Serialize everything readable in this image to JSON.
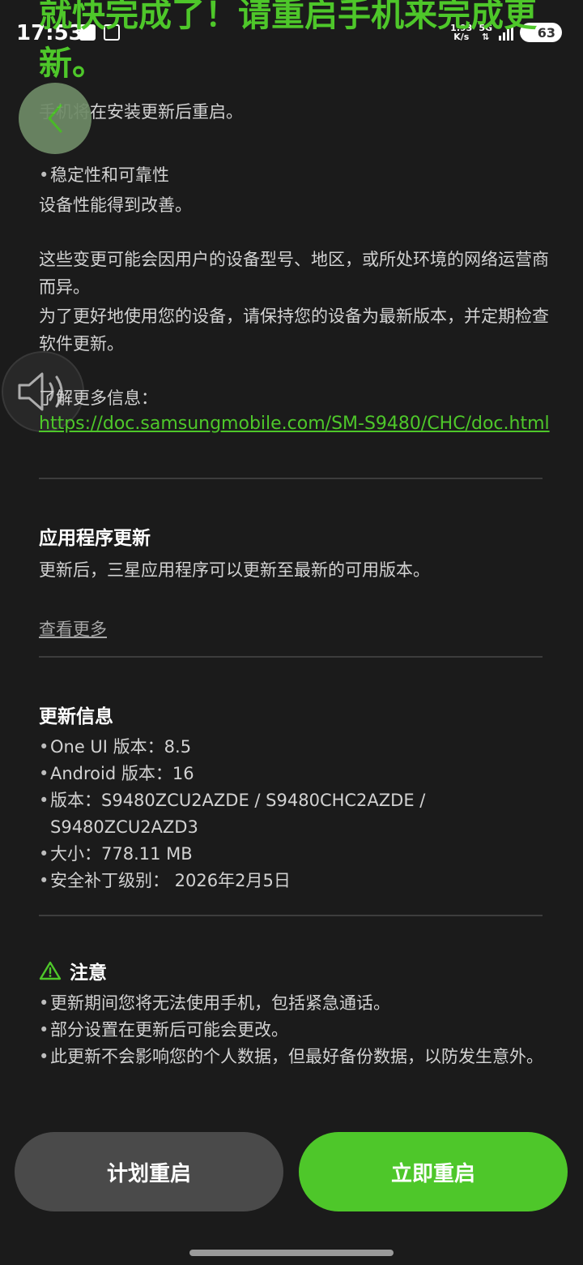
{
  "status_bar": {
    "time": "17:53",
    "net_speed_value": "1.93",
    "net_speed_unit": "K/s",
    "network_type": "5G",
    "battery": "63"
  },
  "title": "就快完成了！请重启手机来完成更新。",
  "intro_text": "手机将在安装更新后重启。",
  "stability": {
    "bullet": "稳定性和可靠性",
    "desc": "设备性能得到改善。"
  },
  "disclaimer_1": "这些变更可能会因用户的设备型号、地区，或所处环境的网络运营商而异。",
  "disclaimer_2": "为了更好地使用您的设备，请保持您的设备为最新版本，并定期检查软件更新。",
  "more_info_label": "了解更多信息：",
  "more_info_url": "https://doc.samsungmobile.com/SM-S9480/CHC/doc.html",
  "app_update": {
    "title": "应用程序更新",
    "desc": "更新后，三星应用程序可以更新至最新的可用版本。",
    "more_link": "查看更多"
  },
  "update_info": {
    "title": "更新信息",
    "items": [
      "One UI 版本：8.5",
      "Android 版本：16",
      "版本：S9480ZCU2AZDE / S9480CHC2AZDE / S9480ZCU2AZD3",
      "大小：778.11 MB",
      "安全补丁级别： 2026年2月5日"
    ]
  },
  "notice": {
    "title": "注意",
    "items": [
      "更新期间您将无法使用手机，包括紧急通话。",
      "部分设置在更新后可能会更改。",
      "此更新不会影响您的个人数据，但最好备份数据，以防发生意外。"
    ]
  },
  "buttons": {
    "schedule": "计划重启",
    "restart_now": "立即重启"
  },
  "colors": {
    "accent": "#4ec72a",
    "background": "#1b1b1b",
    "secondary_button": "#4a4a4a"
  },
  "icons": {
    "back": "chevron-left-icon",
    "volume": "speaker-icon",
    "warning": "warning-triangle-icon"
  }
}
